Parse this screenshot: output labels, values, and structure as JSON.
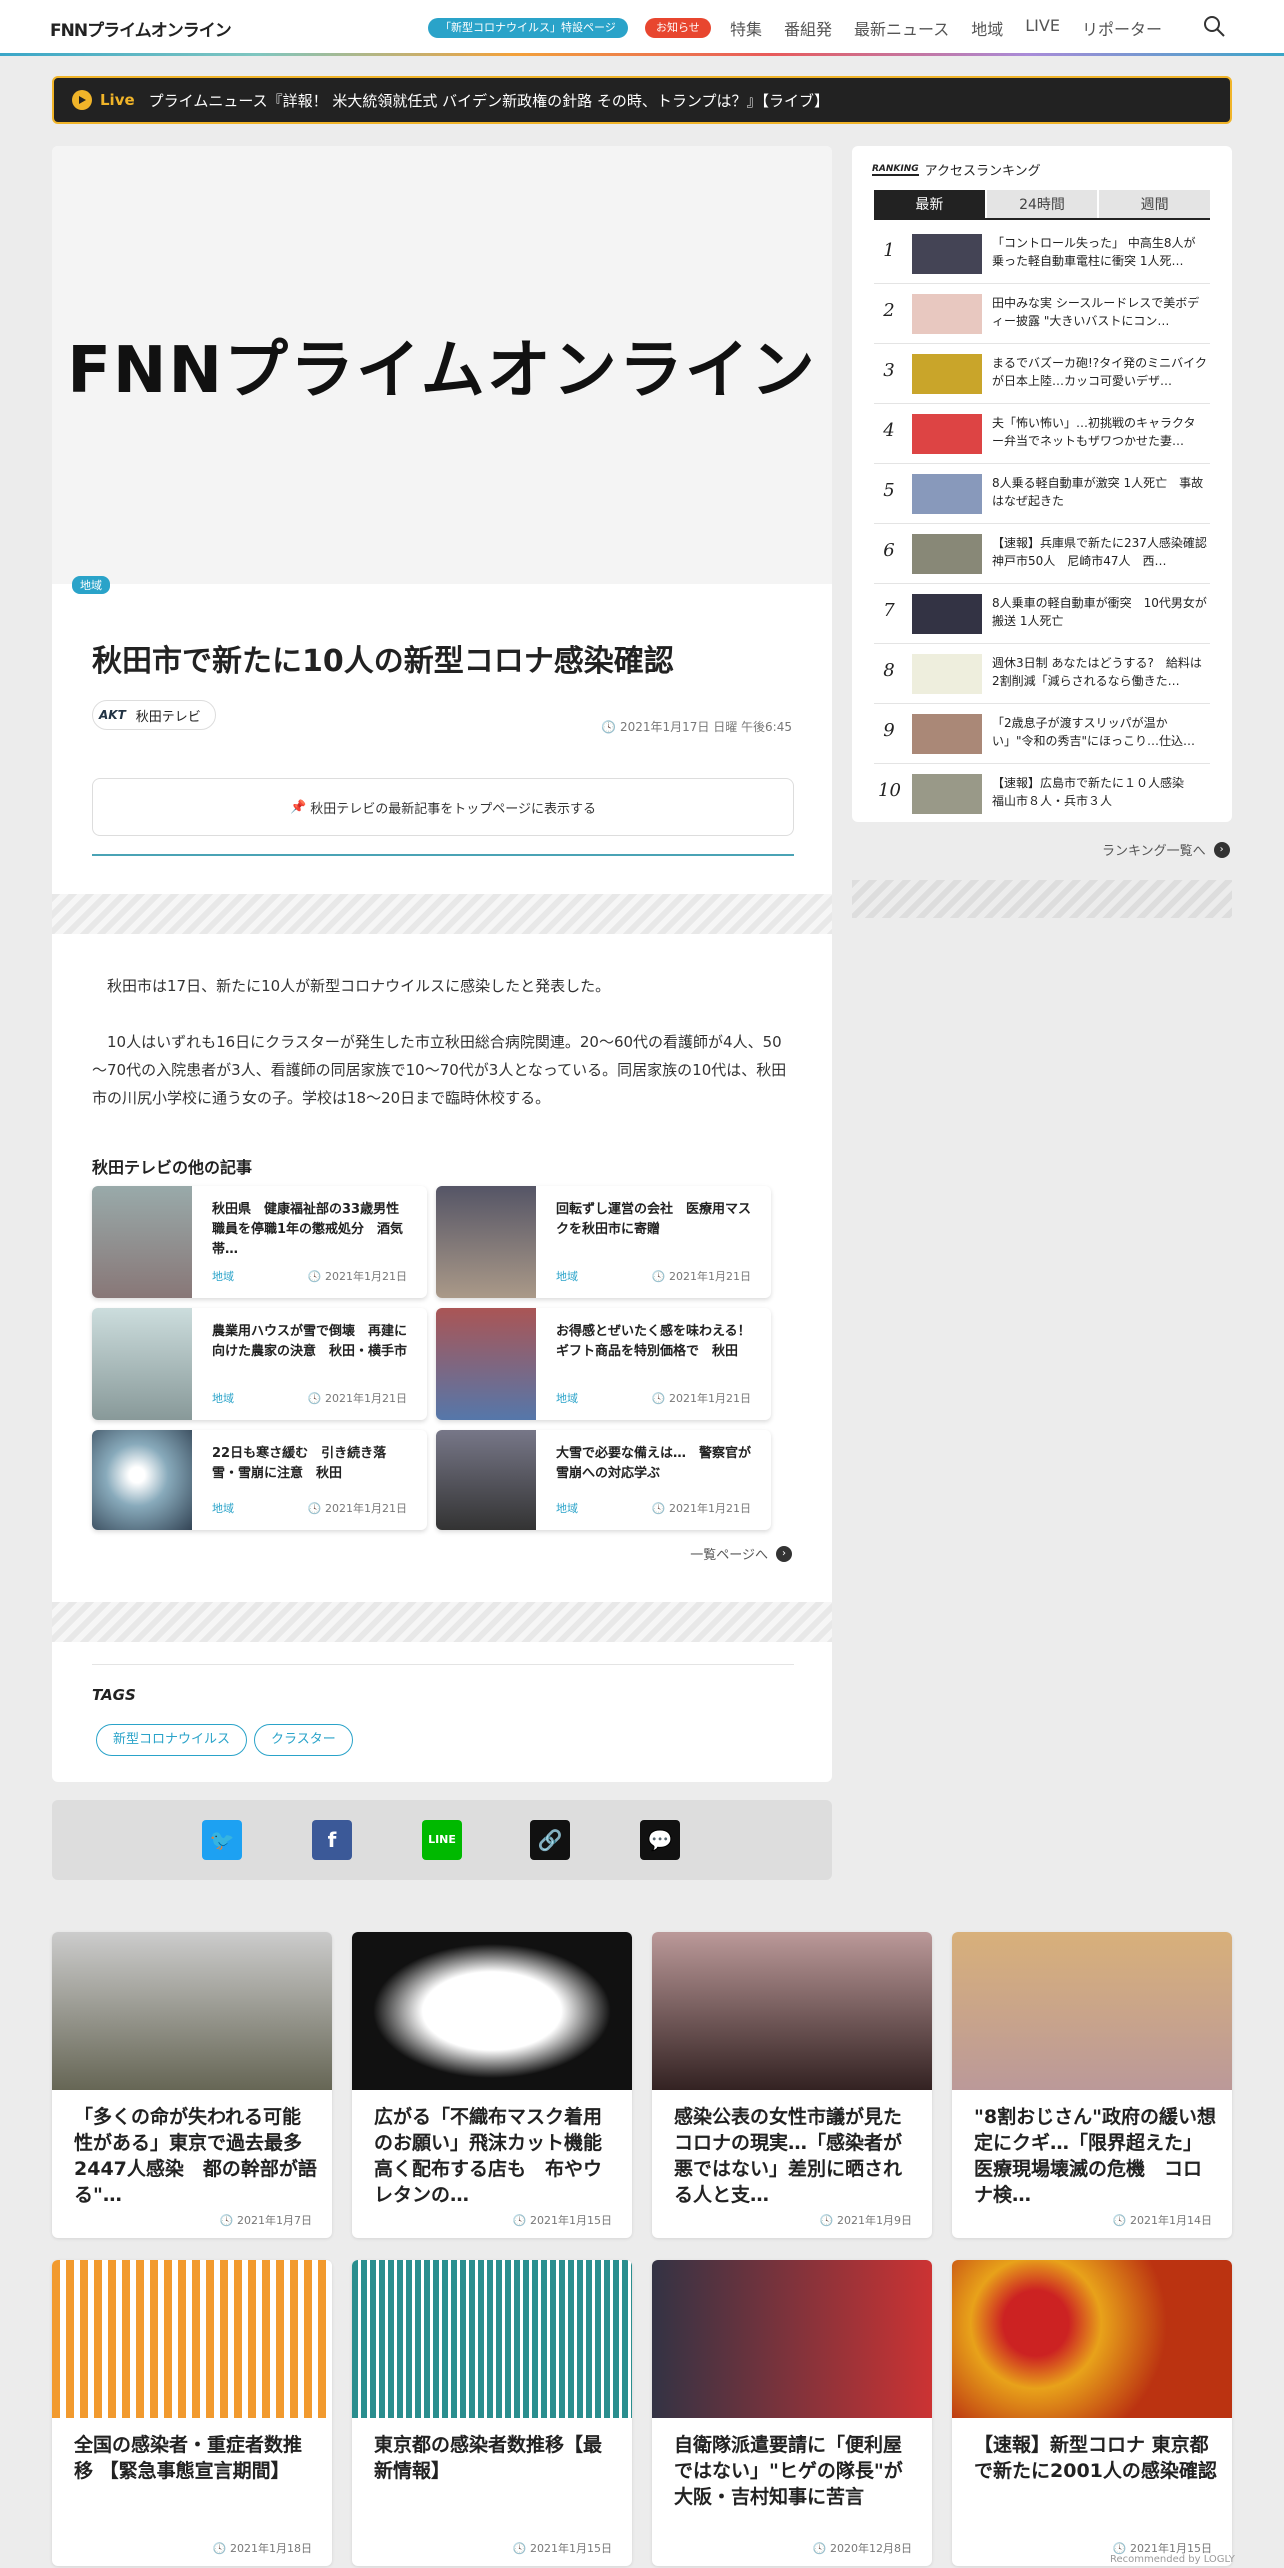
{
  "header": {
    "logo": "FNNプライムオンライン",
    "corona_pill": "「新型コロナウイルス」特設ページ",
    "notice_pill": "お知らせ",
    "nav": [
      "特集",
      "番組発",
      "最新ニュース",
      "地域",
      "LIVE",
      "リポーター"
    ]
  },
  "live": {
    "label": "Live",
    "text": "プライムニュース『詳報！ 米大統領就任式 バイデン新政権の針路 その時、トランプは？』【ライブ】"
  },
  "article": {
    "category": "地域",
    "title": "秋田市で新たに10人の新型コロナ感染確認",
    "source": "秋田テレビ",
    "source_mark": "AKT",
    "date": "2021年1月17日 日曜 午後6:45",
    "top_button": "秋田テレビの最新記事をトップページに表示する",
    "p1": "秋田市は17日、新たに10人が新型コロナウイルスに感染したと発表した。",
    "p2": "10人はいずれも16日にクラスターが発生した市立秋田総合病院関連。20～60代の看護師が4人、50～70代の入院患者が3人、看護師の同居家族で10～70代が3人となっている。同居家族の10代は、秋田市の川尻小学校に通う女の子。学校は18～20日まで臨時休校する。"
  },
  "related": {
    "heading": "秋田テレビの他の記事",
    "more": "一覧ページへ",
    "items": [
      {
        "title": "秋田県　健康福祉部の33歳男性職員を停職1年の懲戒処分　酒気帯…",
        "cat": "地域",
        "date": "2021年1月21日"
      },
      {
        "title": "回転ずし運営の会社　医療用マスクを秋田市に寄贈",
        "cat": "地域",
        "date": "2021年1月21日"
      },
      {
        "title": "農業用ハウスが雪で倒壊　再建に向けた農家の決意　秋田・横手市",
        "cat": "地域",
        "date": "2021年1月21日"
      },
      {
        "title": "お得感とぜいたく感を味わえる！　ギフト商品を特別価格で　秋田",
        "cat": "地域",
        "date": "2021年1月21日"
      },
      {
        "title": "22日も寒さ緩む　引き続き落雪・雪崩に注意　秋田",
        "cat": "地域",
        "date": "2021年1月21日"
      },
      {
        "title": "大雪で必要な備えは…　警察官が雪崩への対応学ぶ",
        "cat": "地域",
        "date": "2021年1月21日"
      }
    ]
  },
  "tags": {
    "heading": "TAGS",
    "items": [
      "新型コロナウイルス",
      "クラスター"
    ]
  },
  "ranking": {
    "heading": "アクセスランキング",
    "heading_mark": "RANKING",
    "tabs": [
      "最新",
      "24時間",
      "週間"
    ],
    "more": "ランキング一覧へ",
    "items": [
      {
        "n": "1",
        "t": "「コントロール失った」 中高生8人が乗った軽自動車電柱に衝突 1人死…"
      },
      {
        "n": "2",
        "t": "田中みな実 シースルードレスで美ボディー披露 \"大きいバストにコン…"
      },
      {
        "n": "3",
        "t": "まるでバズーカ砲!?タイ発のミニバイクが日本上陸…カッコ可愛いデザ…"
      },
      {
        "n": "4",
        "t": "夫「怖い怖い」…初挑戦のキャラクター弁当でネットもザワつかせた妻…"
      },
      {
        "n": "5",
        "t": "8人乗る軽自動車が激突 1人死亡　事故はなぜ起きた"
      },
      {
        "n": "6",
        "t": "【速報】兵庫県で新たに237人感染確認　神戸市50人　尼崎市47人　西…"
      },
      {
        "n": "7",
        "t": "8人乗車の軽自動車が衝突　10代男女が搬送 1人死亡"
      },
      {
        "n": "8",
        "t": "週休3日制 あなたはどうする?　給料は2割削減「減らされるなら働きた…"
      },
      {
        "n": "9",
        "t": "「2歳息子が渡すスリッパが温かい」\"令和の秀吉\"にほっこり…仕込…"
      },
      {
        "n": "10",
        "t": "【速報】広島市で新たに１０人感染　福山市８人・兵市３人"
      }
    ]
  },
  "cards": [
    {
      "title": "「多くの命が失われる可能性がある」東京で過去最多2447人感染　都の幹部が語る\"…",
      "date": "2021年1月7日"
    },
    {
      "title": "広がる「不織布マスク着用のお願い」飛沫カット機能高く配布する店も　布やウレタンの…",
      "date": "2021年1月15日"
    },
    {
      "title": "感染公表の女性市議が見たコロナの現実…「感染者が悪ではない」差別に晒される人と支…",
      "date": "2021年1月9日"
    },
    {
      "title": "\"8割おじさん\"政府の緩い想定にクギ…「限界超えた」医療現場壊滅の危機　コロナ検…",
      "date": "2021年1月14日"
    },
    {
      "title": "全国の感染者・重症者数推移 【緊急事態宣言期間】",
      "date": "2021年1月18日"
    },
    {
      "title": "東京都の感染者数推移【最新情報】",
      "date": "2021年1月15日"
    },
    {
      "title": "自衛隊派遣要請に「便利屋ではない」\"ヒゲの隊長\"が大阪・吉村知事に苦言",
      "date": "2020年12月8日"
    },
    {
      "title": "【速報】新型コロナ 東京都で新たに2001人の感染確認",
      "date": "2021年1月15日"
    }
  ],
  "recommended": "Recommended by LOGLY"
}
